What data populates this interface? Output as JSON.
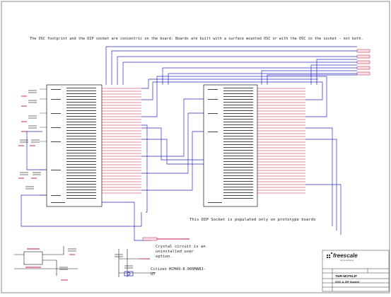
{
  "notes": {
    "top": "The OSC footprint and the DIP socket are concentric on the board. Boards are built with a surface mounted OSC or with the OSC in the socket - not both.",
    "dip": "This DIP Socket is populated only on prototype boards",
    "crystal": "Crystal circuit is an uninstalled user option.",
    "citizen": "Citizen HCM49-8.000MABJ-UT"
  },
  "title_block": {
    "logo": "freescale",
    "logo_sub": "semiconductor",
    "title": "TWR-MCF51JF",
    "subtitle": "OSC & ZIF Socket"
  },
  "colors": {
    "wire": "#2b2bbf",
    "net": "#c8143c",
    "part": "#1a1a1a",
    "border": "#333333"
  }
}
